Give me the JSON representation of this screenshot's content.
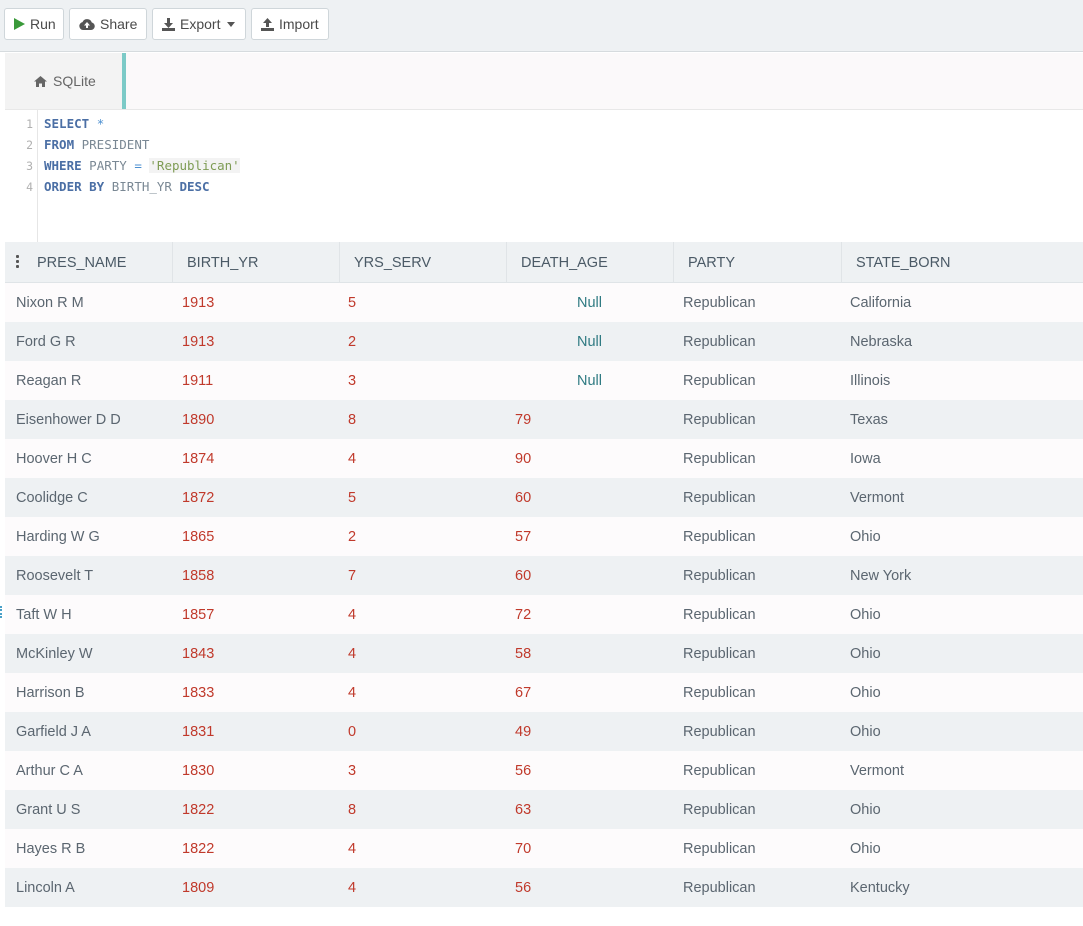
{
  "toolbar": {
    "run_label": "Run",
    "share_label": "Share",
    "export_label": "Export",
    "import_label": "Import"
  },
  "tab": {
    "label": "SQLite"
  },
  "editor": {
    "line_numbers": [
      "1",
      "2",
      "3",
      "4"
    ],
    "lines": [
      [
        "SELECT",
        " ",
        "*"
      ],
      [
        "FROM",
        " PRESIDENT"
      ],
      [
        "WHERE",
        " PARTY ",
        "=",
        " ",
        "'Republican'"
      ],
      [
        "ORDER BY",
        " BIRTH_YR ",
        "DESC"
      ]
    ]
  },
  "table": {
    "columns": [
      "PRES_NAME",
      "BIRTH_YR",
      "YRS_SERV",
      "DEATH_AGE",
      "PARTY",
      "STATE_BORN"
    ],
    "rows": [
      [
        "Nixon R M",
        "1913",
        "5",
        "Null",
        "Republican",
        "California"
      ],
      [
        "Ford G R",
        "1913",
        "2",
        "Null",
        "Republican",
        "Nebraska"
      ],
      [
        "Reagan R",
        "1911",
        "3",
        "Null",
        "Republican",
        "Illinois"
      ],
      [
        "Eisenhower D D",
        "1890",
        "8",
        "79",
        "Republican",
        "Texas"
      ],
      [
        "Hoover H C",
        "1874",
        "4",
        "90",
        "Republican",
        "Iowa"
      ],
      [
        "Coolidge C",
        "1872",
        "5",
        "60",
        "Republican",
        "Vermont"
      ],
      [
        "Harding W G",
        "1865",
        "2",
        "57",
        "Republican",
        "Ohio"
      ],
      [
        "Roosevelt T",
        "1858",
        "7",
        "60",
        "Republican",
        "New York"
      ],
      [
        "Taft W H",
        "1857",
        "4",
        "72",
        "Republican",
        "Ohio"
      ],
      [
        "McKinley W",
        "1843",
        "4",
        "58",
        "Republican",
        "Ohio"
      ],
      [
        "Harrison B",
        "1833",
        "4",
        "67",
        "Republican",
        "Ohio"
      ],
      [
        "Garfield J A",
        "1831",
        "0",
        "49",
        "Republican",
        "Ohio"
      ],
      [
        "Arthur C A",
        "1830",
        "3",
        "56",
        "Republican",
        "Vermont"
      ],
      [
        "Grant U S",
        "1822",
        "8",
        "63",
        "Republican",
        "Ohio"
      ],
      [
        "Hayes R B",
        "1822",
        "4",
        "70",
        "Republican",
        "Ohio"
      ],
      [
        "Lincoln A",
        "1809",
        "4",
        "56",
        "Republican",
        "Kentucky"
      ]
    ]
  },
  "colors": {
    "accent_tab": "#7ccac7",
    "run_icon": "#3a9a3a",
    "number_text": "#c0392b",
    "null_text": "#2f7a82",
    "keyword": "#4b6fa5",
    "string": "#7e9c54"
  },
  "icons": {
    "run": "play-icon",
    "share": "cloud-upload-icon",
    "export": "download-icon",
    "import": "upload-icon",
    "tab": "home-icon"
  }
}
